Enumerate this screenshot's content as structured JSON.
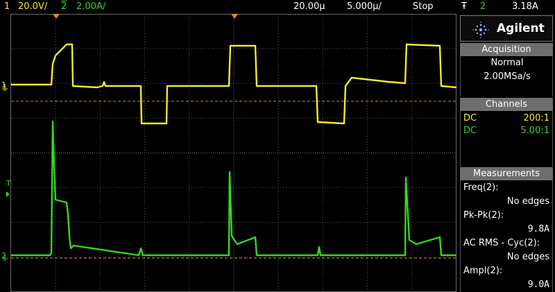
{
  "topbar": {
    "ch1_num": "1",
    "ch1_scale": "20.0V/",
    "ch2_num": "2",
    "ch2_scale": "2.00A/",
    "time_offset": "20.00µ",
    "time_scale": "5.000µ/",
    "run_state": "Stop",
    "trigger_symbol": "Ŧ",
    "trigger_source": "2",
    "trigger_level": "3.18A"
  },
  "panel": {
    "brand": "Agilent",
    "acquisition": {
      "title": "Acquisition",
      "mode": "Normal",
      "rate": "2.00MSa/s"
    },
    "channels": {
      "title": "Channels",
      "rows": [
        {
          "coupling": "DC",
          "probe": "200:1"
        },
        {
          "coupling": "DC",
          "probe": "5.00:1"
        }
      ]
    },
    "measurements": {
      "title": "Measurements",
      "items": [
        {
          "name": "Freq(2):",
          "value": "No edges"
        },
        {
          "name": "Pk-Pk(2):",
          "value": "9.8A"
        },
        {
          "name": "AC RMS - Cyc(2):",
          "value": "No edges"
        },
        {
          "name": "Ampl(2):",
          "value": "9.0A"
        }
      ]
    }
  },
  "markers": {
    "ch1_marker": "1",
    "ch2_marker": "2",
    "trigger_marker": "T"
  },
  "colors": {
    "ch1": "#f5ea2a",
    "ch2": "#34d81e",
    "trigger_ref": "#e08a1e",
    "grid": "#5a5a5a",
    "panel_header": "#6e6e6e"
  }
}
